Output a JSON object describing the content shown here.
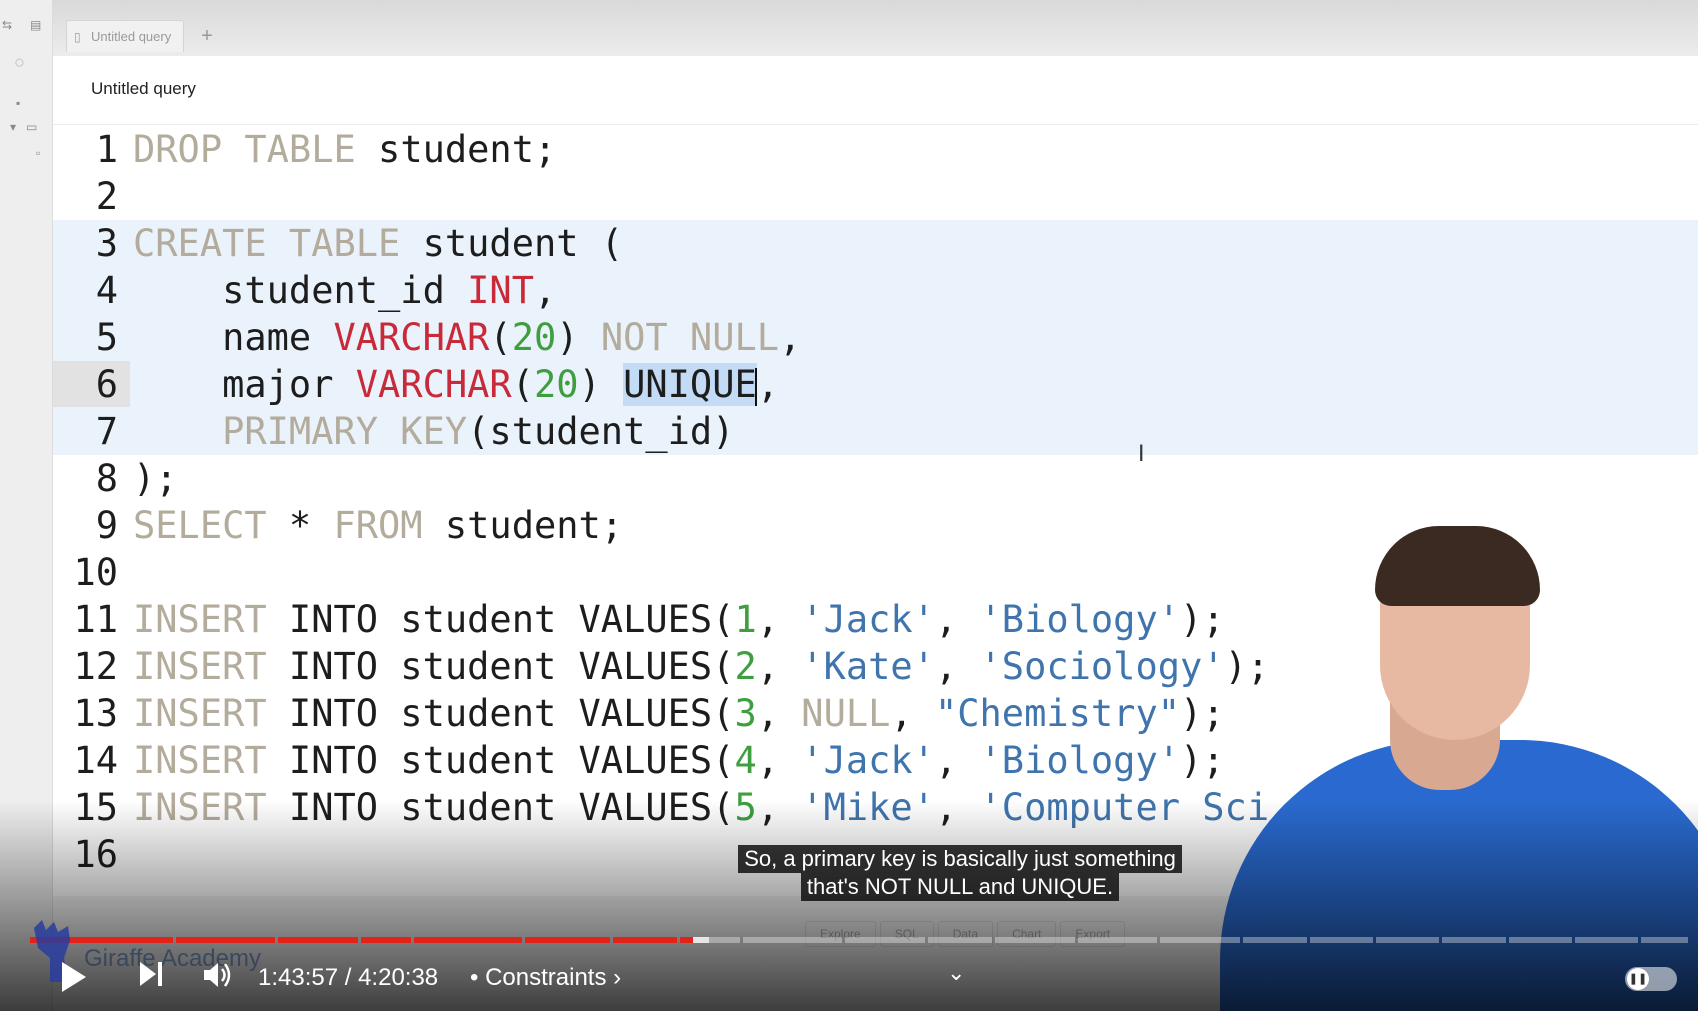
{
  "app": {
    "tab_title": "Untitled query",
    "query_title": "Untitled query",
    "new_tab_symbol": "+"
  },
  "editor": {
    "active_line": 6,
    "lines": [
      {
        "n": "1",
        "tokens": [
          [
            "kw",
            "DROP TABLE"
          ],
          [
            "tx",
            " student;"
          ]
        ]
      },
      {
        "n": "2",
        "tokens": []
      },
      {
        "n": "3",
        "tokens": [
          [
            "kw",
            "CREATE TABLE"
          ],
          [
            "tx",
            " student ("
          ]
        ]
      },
      {
        "n": "4",
        "tokens": [
          [
            "tx",
            "    student_id "
          ],
          [
            "ty",
            "INT"
          ],
          [
            "tx",
            ","
          ]
        ]
      },
      {
        "n": "5",
        "tokens": [
          [
            "tx",
            "    name "
          ],
          [
            "ty",
            "VARCHAR"
          ],
          [
            "tx",
            "("
          ],
          [
            "nu",
            "20"
          ],
          [
            "tx",
            ") "
          ],
          [
            "kw",
            "NOT NULL"
          ],
          [
            "tx",
            ","
          ]
        ]
      },
      {
        "n": "6",
        "tokens": [
          [
            "tx",
            "    major "
          ],
          [
            "ty",
            "VARCHAR"
          ],
          [
            "tx",
            "("
          ],
          [
            "nu",
            "20"
          ],
          [
            "tx",
            ") "
          ],
          [
            "sel",
            "UNIQUE"
          ],
          [
            "caret",
            ""
          ],
          [
            "tx",
            ","
          ]
        ]
      },
      {
        "n": "7",
        "tokens": [
          [
            "kw",
            "    PRIMARY KEY"
          ],
          [
            "tx",
            "(student_id)"
          ]
        ]
      },
      {
        "n": "8",
        "tokens": [
          [
            "tx",
            ");"
          ]
        ]
      },
      {
        "n": "9",
        "tokens": [
          [
            "kw",
            "SELECT"
          ],
          [
            "tx",
            " * "
          ],
          [
            "kw",
            "FROM"
          ],
          [
            "tx",
            " student;"
          ]
        ]
      },
      {
        "n": "10",
        "tokens": []
      },
      {
        "n": "11",
        "tokens": [
          [
            "kw",
            "INSERT"
          ],
          [
            "tx",
            " INTO student VALUES("
          ],
          [
            "nu",
            "1"
          ],
          [
            "tx",
            ", "
          ],
          [
            "st",
            "'Jack'"
          ],
          [
            "tx",
            ", "
          ],
          [
            "st",
            "'Biology'"
          ],
          [
            "tx",
            ");"
          ]
        ]
      },
      {
        "n": "12",
        "tokens": [
          [
            "kw",
            "INSERT"
          ],
          [
            "tx",
            " INTO student VALUES("
          ],
          [
            "nu",
            "2"
          ],
          [
            "tx",
            ", "
          ],
          [
            "st",
            "'Kate'"
          ],
          [
            "tx",
            ", "
          ],
          [
            "st",
            "'Sociology'"
          ],
          [
            "tx",
            ");"
          ]
        ]
      },
      {
        "n": "13",
        "tokens": [
          [
            "kw",
            "INSERT"
          ],
          [
            "tx",
            " INTO student VALUES("
          ],
          [
            "nu",
            "3"
          ],
          [
            "tx",
            ", "
          ],
          [
            "kw",
            "NULL"
          ],
          [
            "tx",
            ", "
          ],
          [
            "st",
            "\"Chemistry\""
          ],
          [
            "tx",
            ");"
          ]
        ]
      },
      {
        "n": "14",
        "tokens": [
          [
            "kw",
            "INSERT"
          ],
          [
            "tx",
            " INTO student VALUES("
          ],
          [
            "nu",
            "4"
          ],
          [
            "tx",
            ", "
          ],
          [
            "st",
            "'Jack'"
          ],
          [
            "tx",
            ", "
          ],
          [
            "st",
            "'Biology'"
          ],
          [
            "tx",
            ");"
          ]
        ]
      },
      {
        "n": "15",
        "tokens": [
          [
            "kw",
            "INSERT"
          ],
          [
            "tx",
            " INTO student VALUES("
          ],
          [
            "nu",
            "5"
          ],
          [
            "tx",
            ", "
          ],
          [
            "st",
            "'Mike'"
          ],
          [
            "tx",
            ", "
          ],
          [
            "st",
            "'Computer Sci"
          ]
        ]
      },
      {
        "n": "16",
        "tokens": []
      }
    ]
  },
  "results_tabs": [
    "Explore",
    "SQL",
    "Data",
    "Chart",
    "Export"
  ],
  "video": {
    "subtitle_lines": [
      "So, a primary key is basically just something",
      "that's NOT NULL and UNIQUE."
    ],
    "time": "1:43:57 / 4:20:38",
    "chapter": "• Constraints ›",
    "channel": "Giraffe Academy",
    "progress": 0.4
  },
  "colors": {
    "keyword": "#b3ab9b",
    "type": "#c92a3a",
    "number": "#3f9e3f",
    "string": "#3f74ad",
    "progress_played": "#e2231a",
    "selection": "#c3dbf5"
  },
  "icons": [
    "document-icon",
    "plus-icon",
    "play-icon",
    "next-icon",
    "volume-icon",
    "chevron-down-icon",
    "pause-icon"
  ]
}
